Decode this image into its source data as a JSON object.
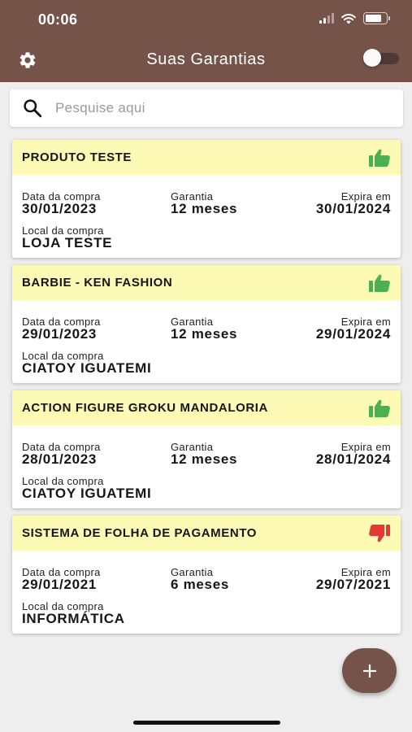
{
  "status_bar": {
    "time": "00:06",
    "battery_level": 0.8
  },
  "header": {
    "title": "Suas Garantias",
    "toggle_on": false,
    "settings_icon": "gear-icon"
  },
  "search": {
    "placeholder": "Pesquise aqui",
    "value": "",
    "icon": "search-icon"
  },
  "labels": {
    "purchase_date": "Data da compra",
    "warranty": "Garantia",
    "expires": "Expira em",
    "store": "Local da compra"
  },
  "items": [
    {
      "name": "PRODUTO TESTE",
      "purchase_date": "30/01/2023",
      "warranty": "12 meses",
      "expires": "30/01/2024",
      "store": "LOJA TESTE",
      "status": "valid",
      "status_icon": "thumbs-up-icon"
    },
    {
      "name": "BARBIE - KEN FASHION",
      "purchase_date": "29/01/2023",
      "warranty": "12 meses",
      "expires": "29/01/2024",
      "store": "CIATOY IGUATEMI",
      "status": "valid",
      "status_icon": "thumbs-up-icon"
    },
    {
      "name": "ACTION FIGURE GROKU MANDALORIA",
      "purchase_date": "28/01/2023",
      "warranty": "12 meses",
      "expires": "28/01/2024",
      "store": "CIATOY IGUATEMI",
      "status": "valid",
      "status_icon": "thumbs-up-icon"
    },
    {
      "name": "SISTEMA DE FOLHA DE PAGAMENTO",
      "purchase_date": "29/01/2021",
      "warranty": "6 meses",
      "expires": "29/07/2021",
      "store": "INFORMÁTICA",
      "status": "expired",
      "status_icon": "thumbs-down-icon"
    }
  ],
  "fab": {
    "icon": "plus-icon"
  },
  "colors": {
    "primary": "#765349",
    "card_header": "#fdfab5",
    "valid": "#4caf50",
    "expired": "#e53935",
    "background": "#efeeee"
  }
}
